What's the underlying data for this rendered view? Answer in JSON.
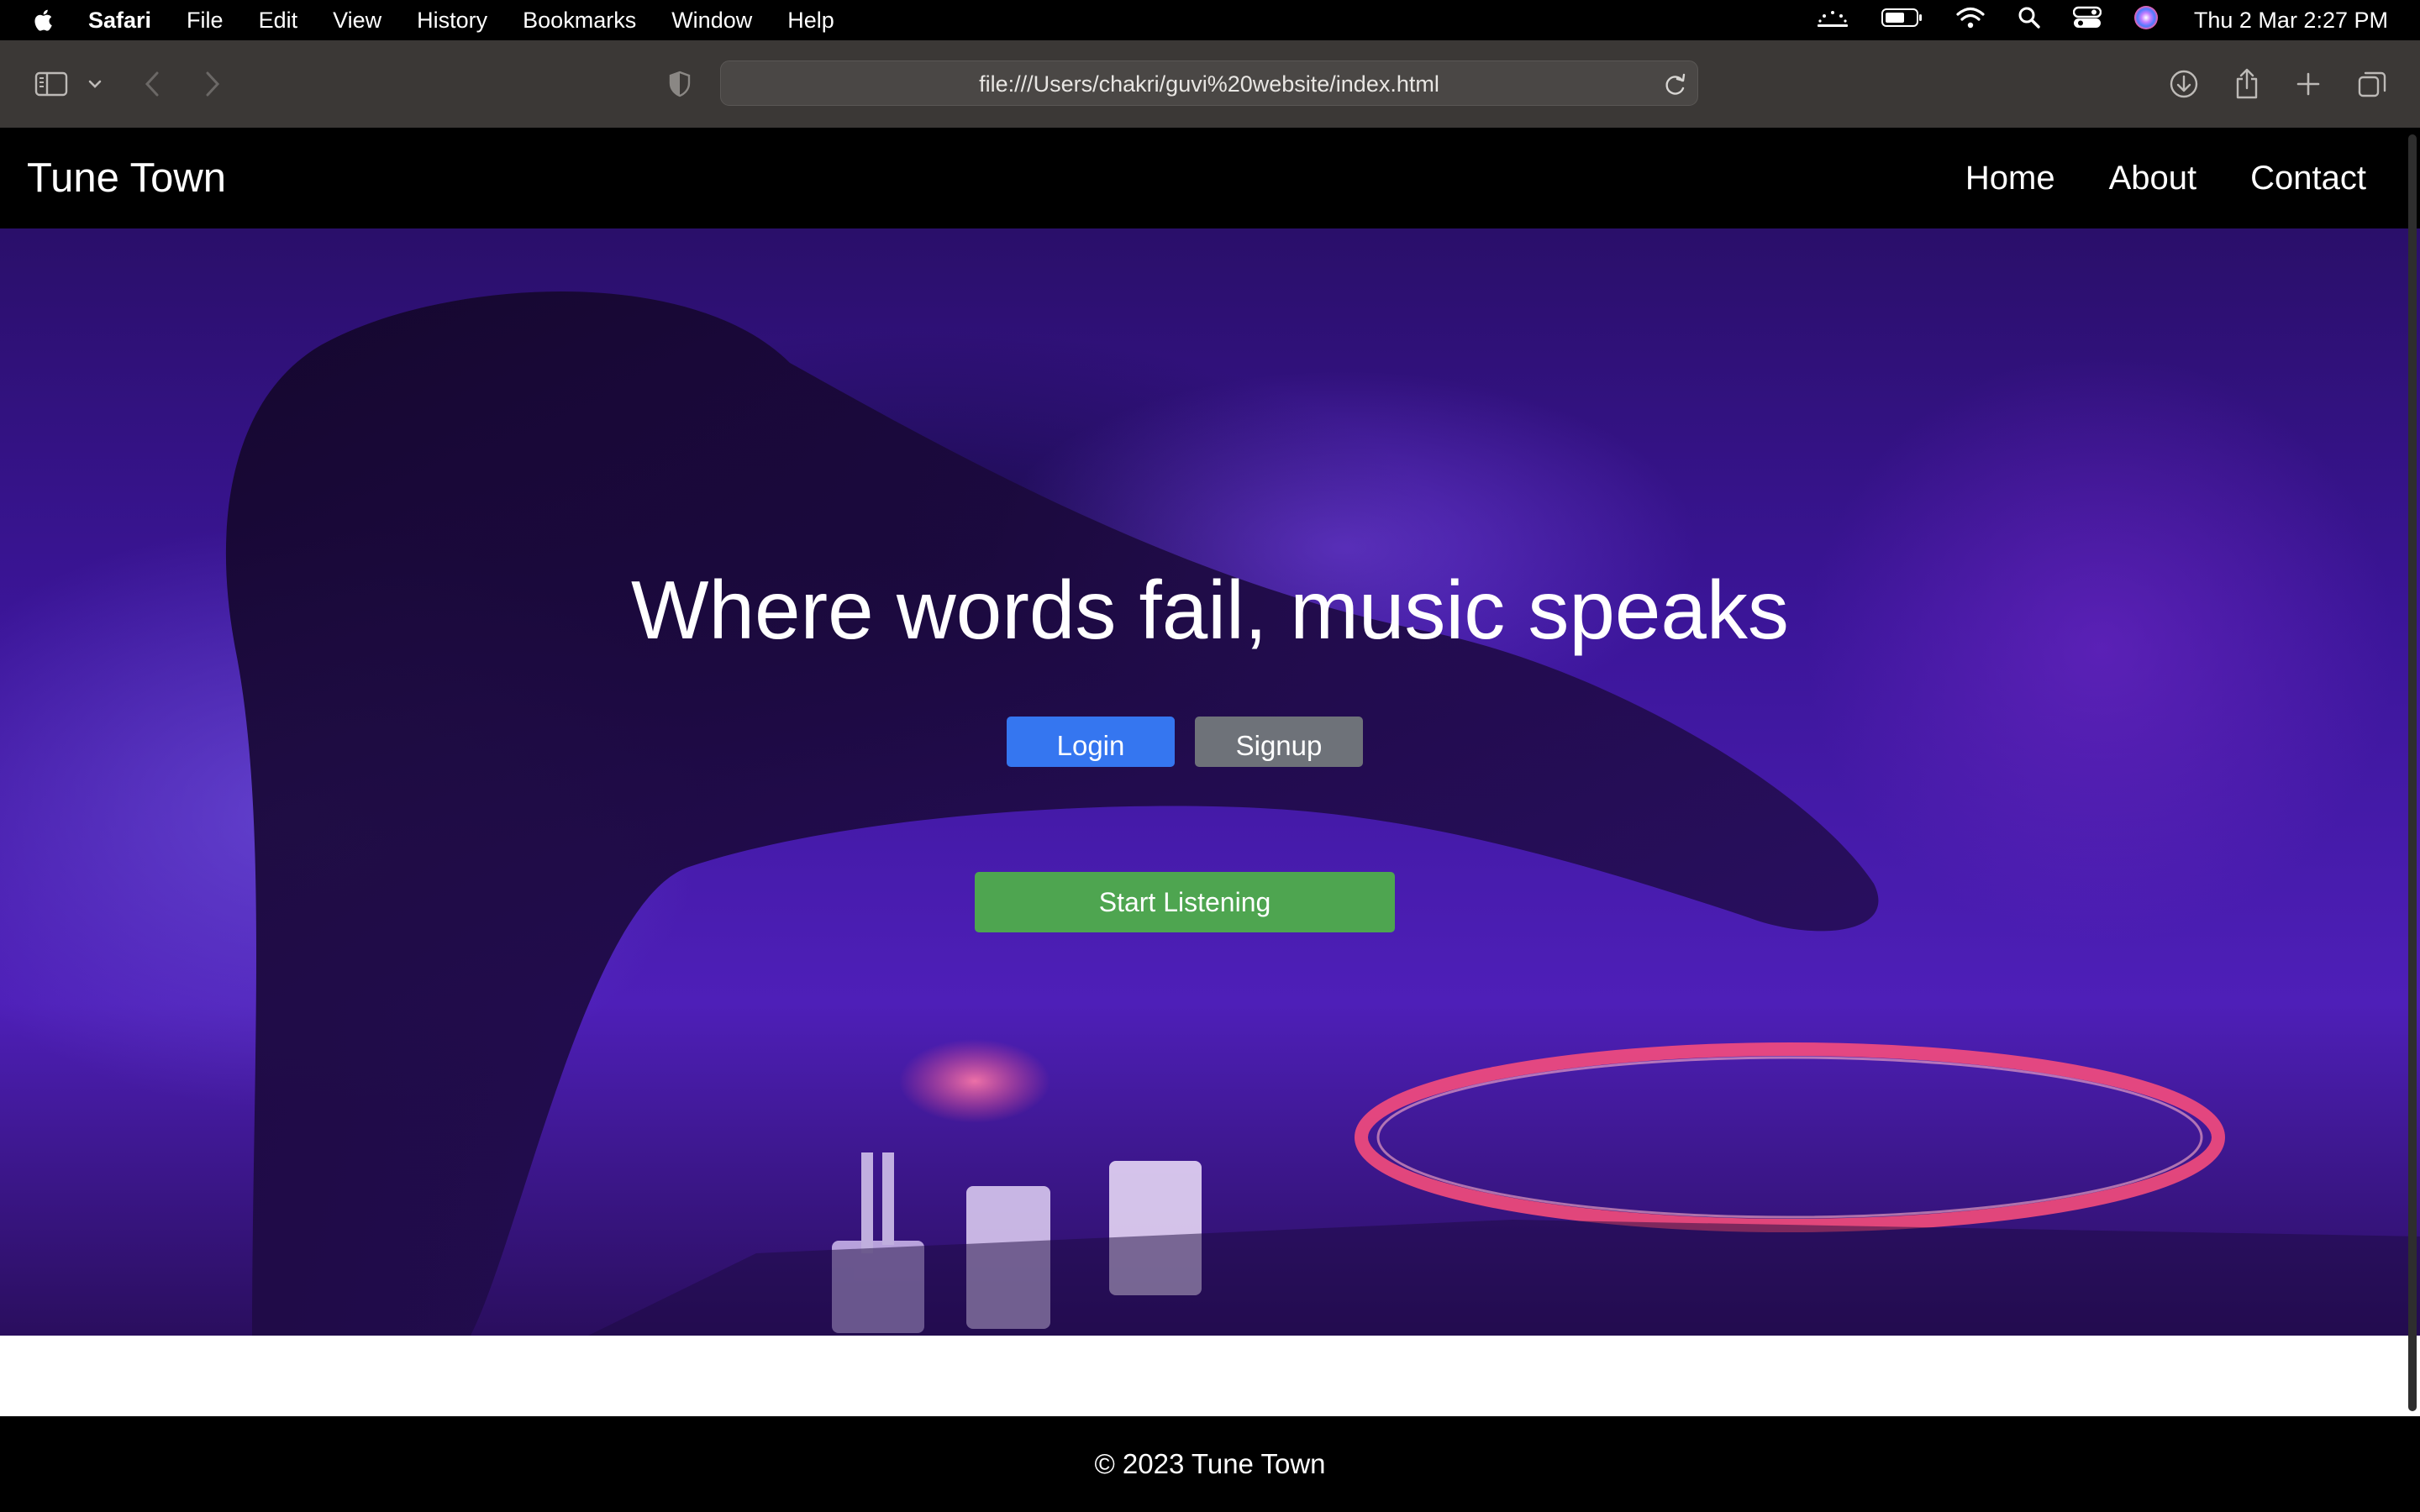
{
  "menubar": {
    "app_name": "Safari",
    "items": [
      "File",
      "Edit",
      "View",
      "History",
      "Bookmarks",
      "Window",
      "Help"
    ],
    "clock": "Thu 2 Mar  2:27 PM"
  },
  "browser": {
    "url": "file:///Users/chakri/guvi%20website/index.html"
  },
  "site": {
    "brand": "Tune Town",
    "nav": [
      "Home",
      "About",
      "Contact"
    ],
    "hero_title": "Where words fail, music speaks",
    "login_label": "Login",
    "signup_label": "Signup",
    "start_label": "Start Listening",
    "footer": "© 2023 Tune Town"
  },
  "colors": {
    "login": "#3576f0",
    "signup": "#6e7279",
    "start": "#4ea550"
  }
}
